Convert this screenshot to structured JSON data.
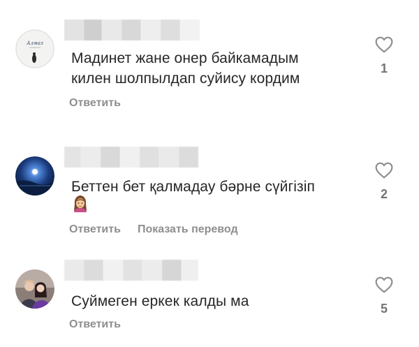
{
  "comments": [
    {
      "text": "Мадинет жане онер байкамадым\nкилен шолпылдап суйису кордим",
      "reply_label": "Ответить",
      "like_count": "1",
      "avatar_text": "Алмаз"
    },
    {
      "text": "Беттен бет қалмадау бәрне сүйгізіп",
      "reply_label": "Ответить",
      "translate_label": "Показать перевод",
      "like_count": "2",
      "emoji": "woman-emoji"
    },
    {
      "text": "Суймеген еркек калды ма",
      "reply_label": "Ответить",
      "like_count": "5"
    }
  ],
  "colors": {
    "text": "#262626",
    "secondary": "#8e8e8e",
    "like_count": "#737373",
    "heart_stroke": "#8e8e8e"
  },
  "icons": {
    "like": "heart-outline-icon"
  }
}
